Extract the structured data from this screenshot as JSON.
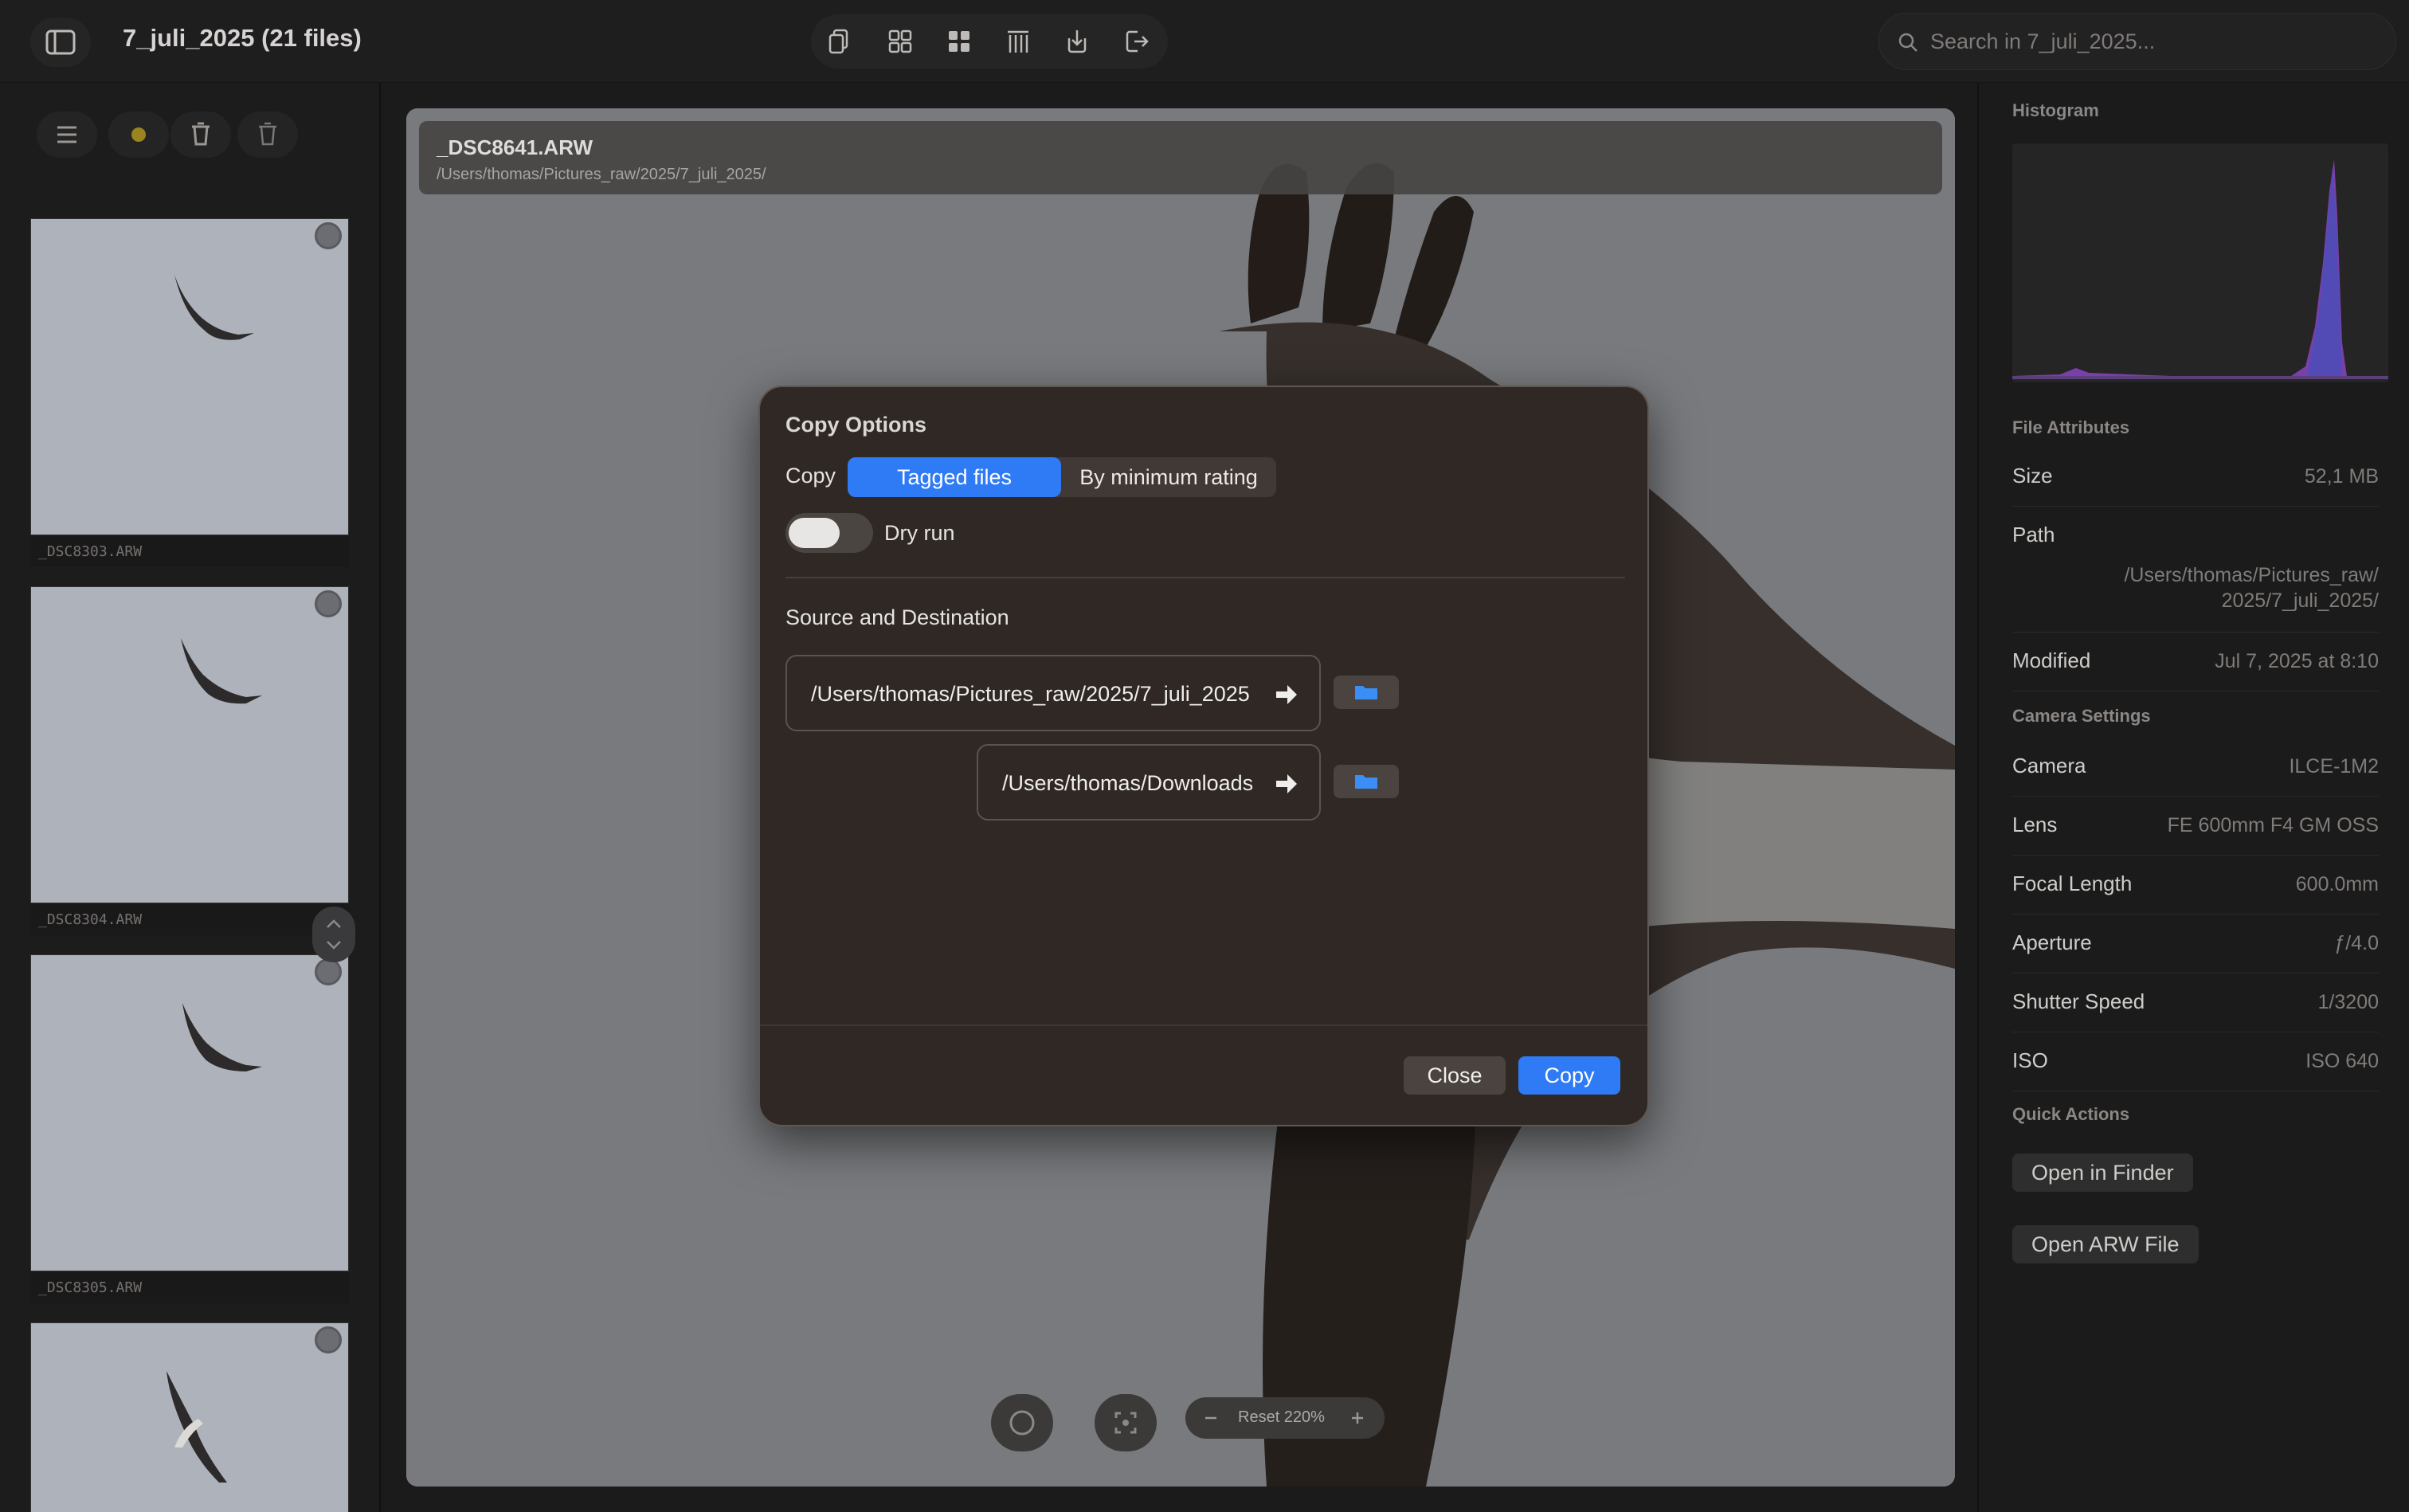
{
  "window": {
    "title": "7_juli_2025 (21 files)"
  },
  "search": {
    "placeholder": "Search in 7_juli_2025..."
  },
  "toolbar": {
    "icons": [
      "copy-icon",
      "grid-icon",
      "grid-filled-icon",
      "columns-icon",
      "import-icon",
      "export-icon"
    ]
  },
  "thumbnails": [
    {
      "label": "_DSC8303.ARW"
    },
    {
      "label": "_DSC8304.ARW"
    },
    {
      "label": "_DSC8305.ARW"
    }
  ],
  "viewer": {
    "file_name": "_DSC8641.ARW",
    "file_path": "/Users/thomas/Pictures_raw/2025/7_juli_2025/",
    "zoom_text": "Reset 220%"
  },
  "panel": {
    "histogram_title": "Histogram",
    "file_attributes_title": "File Attributes",
    "camera_settings_title": "Camera Settings",
    "quick_actions_title": "Quick Actions",
    "size_label": "Size",
    "size_value": "52,1 MB",
    "path_label": "Path",
    "path_value_line1": "/Users/thomas/Pictures_raw/",
    "path_value_line2": "2025/7_juli_2025/",
    "modified_label": "Modified",
    "modified_value": "Jul 7, 2025 at 8:10",
    "camera_label": "Camera",
    "camera_value": "ILCE-1M2",
    "lens_label": "Lens",
    "lens_value": "FE 600mm F4 GM OSS",
    "focal_label": "Focal Length",
    "focal_value": "600.0mm",
    "aperture_label": "Aperture",
    "aperture_value": "ƒ/4.0",
    "shutter_label": "Shutter Speed",
    "shutter_value": "1/3200",
    "iso_label": "ISO",
    "iso_value": "ISO 640",
    "open_finder": "Open in Finder",
    "open_arw": "Open ARW File"
  },
  "modal": {
    "title": "Copy Options",
    "copy_label": "Copy",
    "seg_tagged": "Tagged files",
    "seg_rating": "By minimum rating",
    "dry_run": "Dry run",
    "dry_run_on": false,
    "source_dest_title": "Source and Destination",
    "source_path": "/Users/thomas/Pictures_raw/2025/7_juli_2025",
    "dest_path": "/Users/thomas/Downloads",
    "close": "Close",
    "copy": "Copy"
  },
  "colors": {
    "accent": "#2f7bf5",
    "modal_bg": "#2f2825"
  }
}
